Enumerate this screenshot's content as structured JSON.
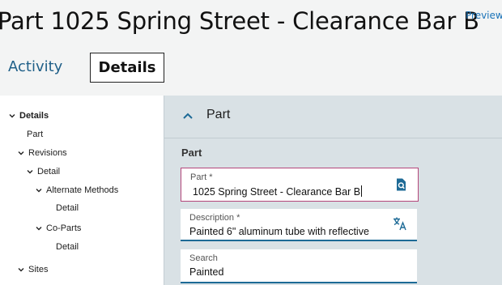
{
  "page": {
    "title": "Part 1025 Spring Street - Clearance Bar B",
    "preview_link": "Preview"
  },
  "tabs": [
    {
      "label": "Activity",
      "active": false
    },
    {
      "label": "Details",
      "active": true
    }
  ],
  "tree": [
    {
      "label": "Details",
      "level": 0,
      "expanded": true,
      "bold": true
    },
    {
      "label": "Part",
      "level": 1,
      "expanded": null,
      "bold": false
    },
    {
      "label": "Revisions",
      "level": 1,
      "expanded": true,
      "bold": false
    },
    {
      "label": "Detail",
      "level": 2,
      "expanded": true,
      "bold": false
    },
    {
      "label": "Alternate Methods",
      "level": 3,
      "expanded": true,
      "bold": false
    },
    {
      "label": "Detail",
      "level": 4,
      "expanded": null,
      "bold": false
    },
    {
      "label": "Co-Parts",
      "level": 3,
      "expanded": true,
      "bold": false
    },
    {
      "label": "Detail",
      "level": 4,
      "expanded": null,
      "bold": false
    },
    {
      "label": "Sites",
      "level": 1,
      "expanded": true,
      "bold": false
    }
  ],
  "section": {
    "title": "Part",
    "expanded": true,
    "group_title": "Part"
  },
  "fields": {
    "part": {
      "label": "Part *",
      "value": "1025 Spring Street - Clearance Bar B",
      "icon": "search-icon"
    },
    "description": {
      "label": "Description *",
      "value": "Painted 6\" aluminum tube with reflective",
      "icon": "translate-icon"
    },
    "search": {
      "label": "Search",
      "value": "Painted"
    }
  },
  "colors": {
    "accent": "#1d6a96",
    "link": "#1a73b8",
    "error_border": "#b4467a",
    "panel_bg": "#d9e1e5"
  }
}
